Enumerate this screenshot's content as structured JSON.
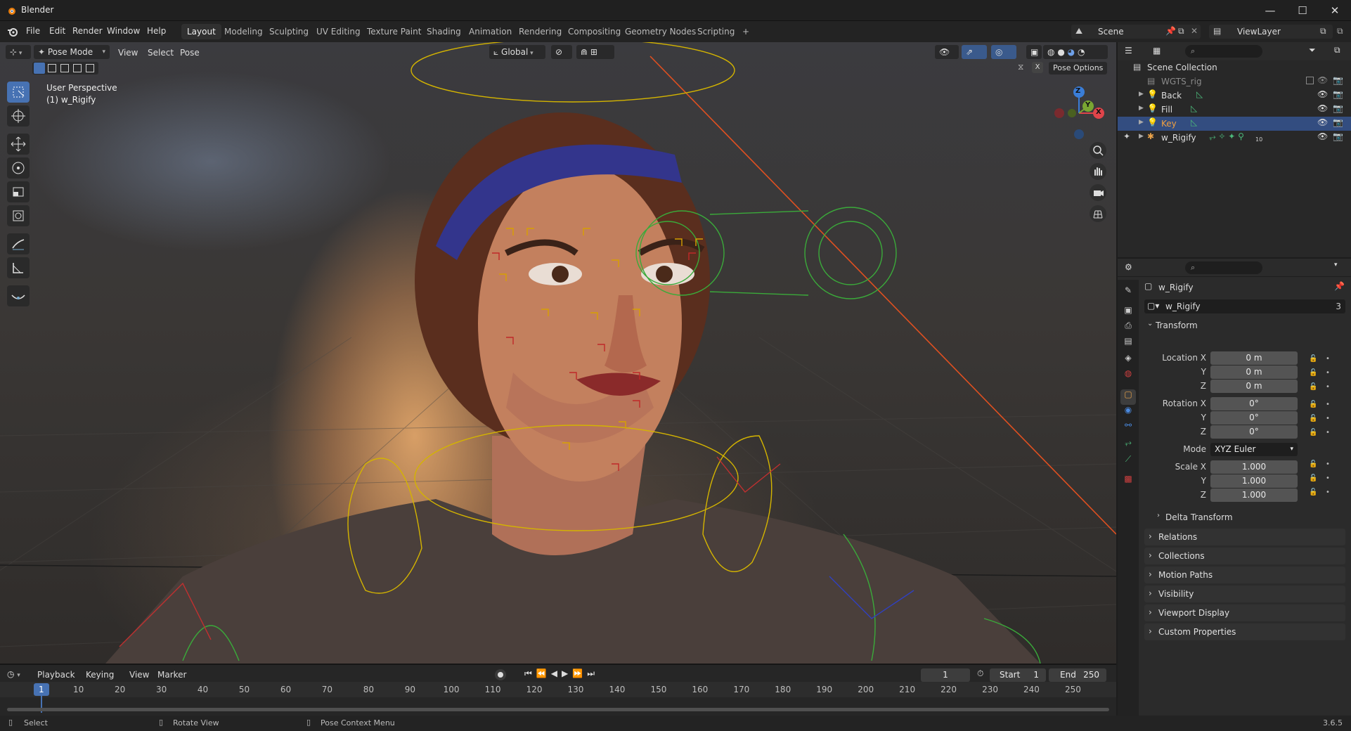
{
  "window": {
    "title": "Blender",
    "minimize": "—",
    "maximize": "☐",
    "close": "✕"
  },
  "menu": {
    "file": "File",
    "edit": "Edit",
    "render": "Render",
    "window": "Window",
    "help": "Help"
  },
  "workspaces": [
    "Layout",
    "Modeling",
    "Sculpting",
    "UV Editing",
    "Texture Paint",
    "Shading",
    "Animation",
    "Rendering",
    "Compositing",
    "Geometry Nodes",
    "Scripting"
  ],
  "workspace_add": "+",
  "scene": {
    "name": "Scene",
    "view_layer": "ViewLayer"
  },
  "viewport": {
    "mode": "Pose Mode",
    "menus": [
      "View",
      "Select",
      "Pose"
    ],
    "orientation": "Global",
    "pose_options": "Pose Options",
    "overlay_line1": "User Perspective",
    "overlay_line2": "(1) w_Rigify",
    "gizmo": {
      "z": "Z",
      "y": "Y",
      "x": "X"
    }
  },
  "timeline": {
    "menus": [
      "Playback",
      "Keying",
      "View",
      "Marker"
    ],
    "current_frame": "1",
    "start_label": "Start",
    "start": "1",
    "end_label": "End",
    "end": "250",
    "ticks": [
      "1",
      "10",
      "20",
      "30",
      "40",
      "50",
      "60",
      "70",
      "80",
      "90",
      "100",
      "110",
      "120",
      "130",
      "140",
      "150",
      "160",
      "170",
      "180",
      "190",
      "200",
      "210",
      "220",
      "230",
      "240",
      "250"
    ]
  },
  "status": {
    "select": "Select",
    "rotate": "Rotate View",
    "context": "Pose Context Menu",
    "version": "3.6.5"
  },
  "outliner": {
    "root": "Scene Collection",
    "items": [
      {
        "label": "WGTS_rig"
      },
      {
        "label": "Back"
      },
      {
        "label": "Fill"
      },
      {
        "label": "Key"
      },
      {
        "label": "w_Rigify",
        "badge": "10"
      }
    ]
  },
  "properties": {
    "object_name": "w_Rigify",
    "data_name": "w_Rigify",
    "user_count": "3",
    "transform_label": "Transform",
    "location_x_label": "Location X",
    "location_x": "0 m",
    "location_y_label": "Y",
    "location_y": "0 m",
    "location_z_label": "Z",
    "location_z": "0 m",
    "rotation_x_label": "Rotation X",
    "rotation_x": "0°",
    "rotation_y_label": "Y",
    "rotation_y": "0°",
    "rotation_z_label": "Z",
    "rotation_z": "0°",
    "mode_label": "Mode",
    "mode": "XYZ Euler",
    "scale_x_label": "Scale X",
    "scale_x": "1.000",
    "scale_y_label": "Y",
    "scale_y": "1.000",
    "scale_z_label": "Z",
    "scale_z": "1.000",
    "delta_transform": "Delta Transform",
    "panels": [
      "Relations",
      "Collections",
      "Motion Paths",
      "Visibility",
      "Viewport Display",
      "Custom Properties"
    ]
  },
  "colors": {
    "accent": "#4772b3",
    "selected_row": "#334d80",
    "key_label": "#f0a040",
    "axis_x": "#e0444a",
    "axis_y": "#7aa632",
    "axis_z": "#3a7dd8"
  }
}
